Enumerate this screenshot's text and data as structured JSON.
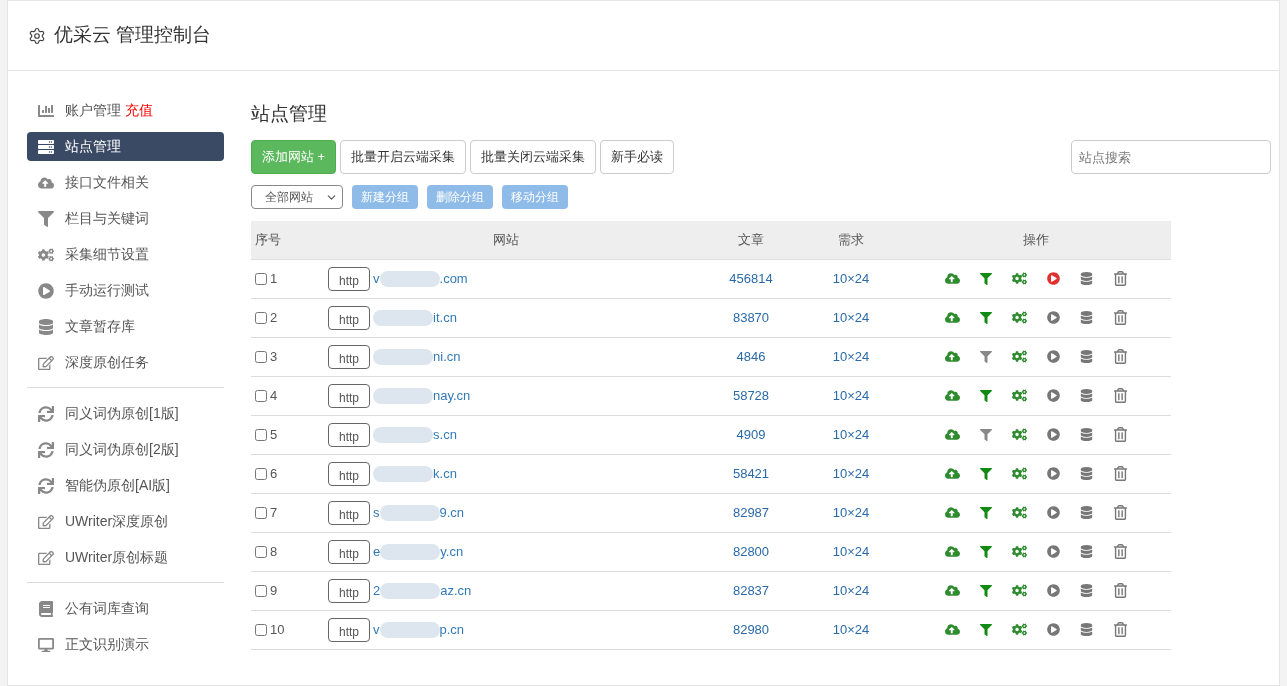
{
  "header": {
    "title": "优采云 管理控制台"
  },
  "sidebar": {
    "groups": [
      {
        "items": [
          {
            "kind": "chart",
            "label": "账户管理",
            "badge": "充值",
            "selected": false
          },
          {
            "kind": "server",
            "label": "站点管理",
            "selected": true
          },
          {
            "kind": "cloud",
            "label": "接口文件相关",
            "selected": false
          },
          {
            "kind": "filter",
            "label": "栏目与关键词",
            "selected": false
          },
          {
            "kind": "gears",
            "label": "采集细节设置",
            "selected": false
          },
          {
            "kind": "play",
            "label": "手动运行测试",
            "selected": false
          },
          {
            "kind": "database",
            "label": "文章暂存库",
            "selected": false
          },
          {
            "kind": "edit",
            "label": "深度原创任务",
            "selected": false
          }
        ]
      },
      {
        "items": [
          {
            "kind": "sync",
            "label": "同义词伪原创[1版]",
            "selected": false
          },
          {
            "kind": "sync",
            "label": "同义词伪原创[2版]",
            "selected": false
          },
          {
            "kind": "sync",
            "label": "智能伪原创[AI版]",
            "selected": false
          },
          {
            "kind": "edit",
            "label": "UWriter深度原创",
            "selected": false
          },
          {
            "kind": "edit",
            "label": "UWriter原创标题",
            "selected": false
          }
        ]
      },
      {
        "items": [
          {
            "kind": "book",
            "label": "公有词库查询",
            "selected": false
          },
          {
            "kind": "desktop",
            "label": "正文识别演示",
            "selected": false
          }
        ]
      }
    ]
  },
  "main": {
    "title": "站点管理",
    "buttons": [
      {
        "label": "添加网站 +",
        "kind": "primary"
      },
      {
        "label": "批量开启云端采集",
        "kind": "default"
      },
      {
        "label": "批量关闭云端采集",
        "kind": "default"
      },
      {
        "label": "新手必读",
        "kind": "default"
      }
    ],
    "search": {
      "placeholder": "站点搜索"
    },
    "group_select": {
      "value": "全部网站"
    },
    "group_buttons": [
      "新建分组",
      "删除分组",
      "移动分组"
    ],
    "table": {
      "columns": [
        "序号",
        "网站",
        "文章",
        "需求",
        "操作"
      ],
      "rows": [
        {
          "checked": false,
          "index": "1",
          "scheme": "http",
          "url_start": "v",
          "url_end": ".com",
          "articles": "456814",
          "demand": "10×24",
          "filter_on": true,
          "running": true
        },
        {
          "checked": false,
          "index": "2",
          "scheme": "http",
          "url_start": "",
          "url_end": "it.cn",
          "articles": "83870",
          "demand": "10×24",
          "filter_on": true,
          "running": false
        },
        {
          "checked": false,
          "index": "3",
          "scheme": "http",
          "url_start": "",
          "url_end": "ni.cn",
          "articles": "4846",
          "demand": "10×24",
          "filter_on": false,
          "running": false
        },
        {
          "checked": false,
          "index": "4",
          "scheme": "http",
          "url_start": "",
          "url_end": "nay.cn",
          "articles": "58728",
          "demand": "10×24",
          "filter_on": true,
          "running": false
        },
        {
          "checked": false,
          "index": "5",
          "scheme": "http",
          "url_start": "",
          "url_end": "s.cn",
          "articles": "4909",
          "demand": "10×24",
          "filter_on": false,
          "running": false
        },
        {
          "checked": false,
          "index": "6",
          "scheme": "http",
          "url_start": "",
          "url_end": "k.cn",
          "articles": "58421",
          "demand": "10×24",
          "filter_on": true,
          "running": false
        },
        {
          "checked": false,
          "index": "7",
          "scheme": "http",
          "url_start": "s",
          "url_end": "9.cn",
          "articles": "82987",
          "demand": "10×24",
          "filter_on": true,
          "running": false
        },
        {
          "checked": false,
          "index": "8",
          "scheme": "http",
          "url_start": "e",
          "url_end": "y.cn",
          "articles": "82800",
          "demand": "10×24",
          "filter_on": true,
          "running": false
        },
        {
          "checked": false,
          "index": "9",
          "scheme": "http",
          "url_start": "2",
          "url_end": "az.cn",
          "articles": "82837",
          "demand": "10×24",
          "filter_on": true,
          "running": false
        },
        {
          "checked": false,
          "index": "10",
          "scheme": "http",
          "url_start": "v",
          "url_end": "p.cn",
          "articles": "82980",
          "demand": "10×24",
          "filter_on": true,
          "running": false
        }
      ]
    }
  }
}
